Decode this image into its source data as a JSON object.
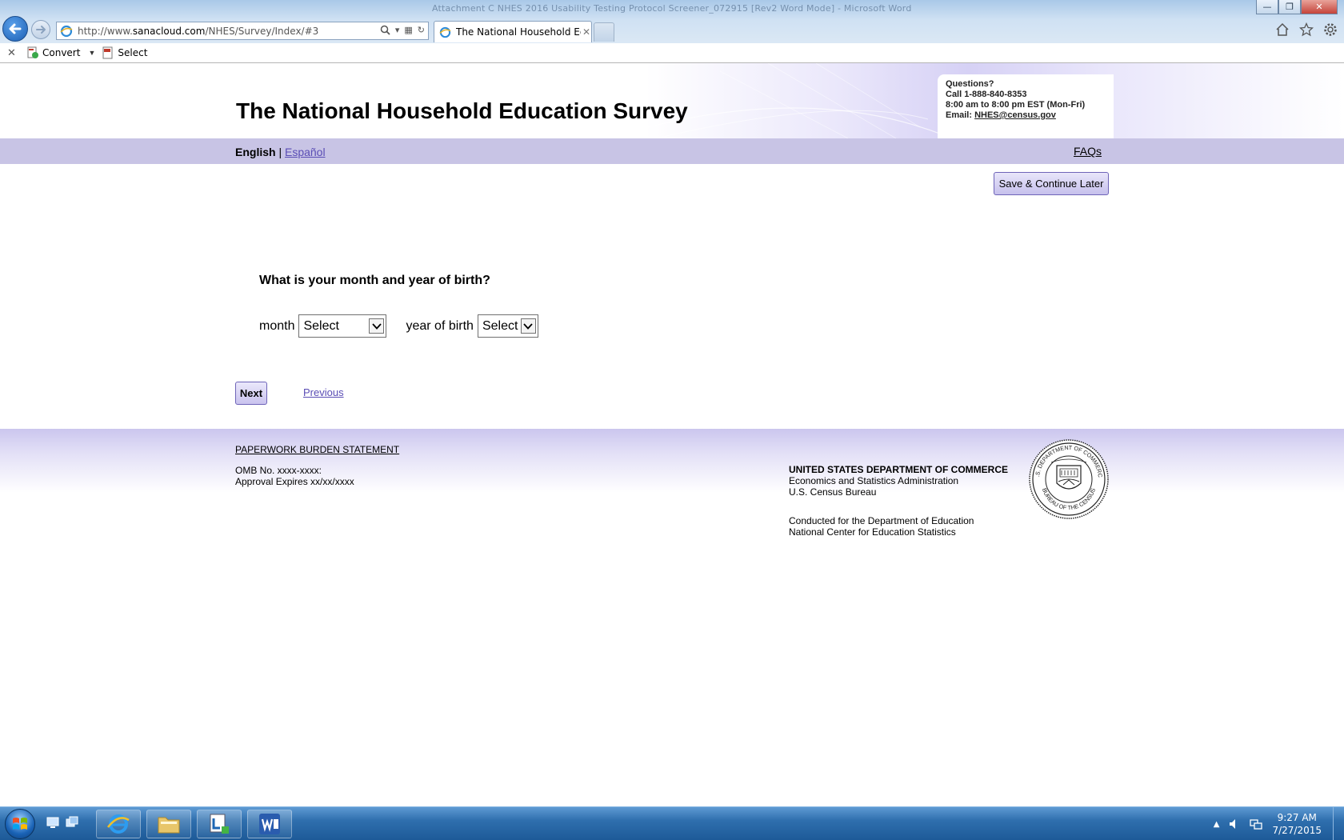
{
  "window": {
    "title": "Attachment C NHES 2016 Usability Testing Protocol Screener_072915 [Rev2 Word Mode] - Microsoft Word"
  },
  "browser": {
    "url_prefix": "http://www.",
    "url_host": "sanacloud.com",
    "url_path": "/NHES/Survey/Index/#3",
    "tab_title": "The National Household Ed...",
    "toolbar": {
      "convert_label": "Convert",
      "select_label": "Select"
    }
  },
  "page": {
    "site_title": "The National Household Education Survey",
    "questions": {
      "heading": "Questions?",
      "phone": "Call 1-888-840-8353",
      "hours": "8:00 am to 8:00 pm EST (Mon-Fri)",
      "email_label": "Email: ",
      "email": "NHES@census.gov"
    },
    "lang": {
      "english": "English",
      "separator": " | ",
      "espanol": "Español"
    },
    "faqs": "FAQs",
    "save_button": "Save & Continue Later",
    "question": "What is your month and year of birth?",
    "month_label": "month",
    "month_value": "Select",
    "year_label": "year of birth",
    "year_value": "Select",
    "next_button": "Next",
    "previous_link": "Previous",
    "footer": {
      "burden_link": "PAPERWORK BURDEN STATEMENT",
      "omb": "OMB No. xxxx-xxxx:",
      "approval": "Approval Expires xx/xx/xxxx",
      "dept": "UNITED STATES DEPARTMENT OF COMMERCE",
      "esa": "Economics and Statistics Administration",
      "bureau": "U.S. Census Bureau",
      "conducted1": "Conducted for the Department of Education",
      "conducted2": "National Center for Education Statistics"
    },
    "seal": {
      "top_text": "U.S. DEPARTMENT OF COMMERCE",
      "bottom_text": "BUREAU OF THE CENSUS"
    }
  },
  "taskbar": {
    "time": "9:27 AM",
    "date": "7/27/2015"
  },
  "colors": {
    "accent_purple": "#c8c4e5",
    "link_purple": "#5a4db5",
    "taskbar_blue": "#2f6fae"
  }
}
